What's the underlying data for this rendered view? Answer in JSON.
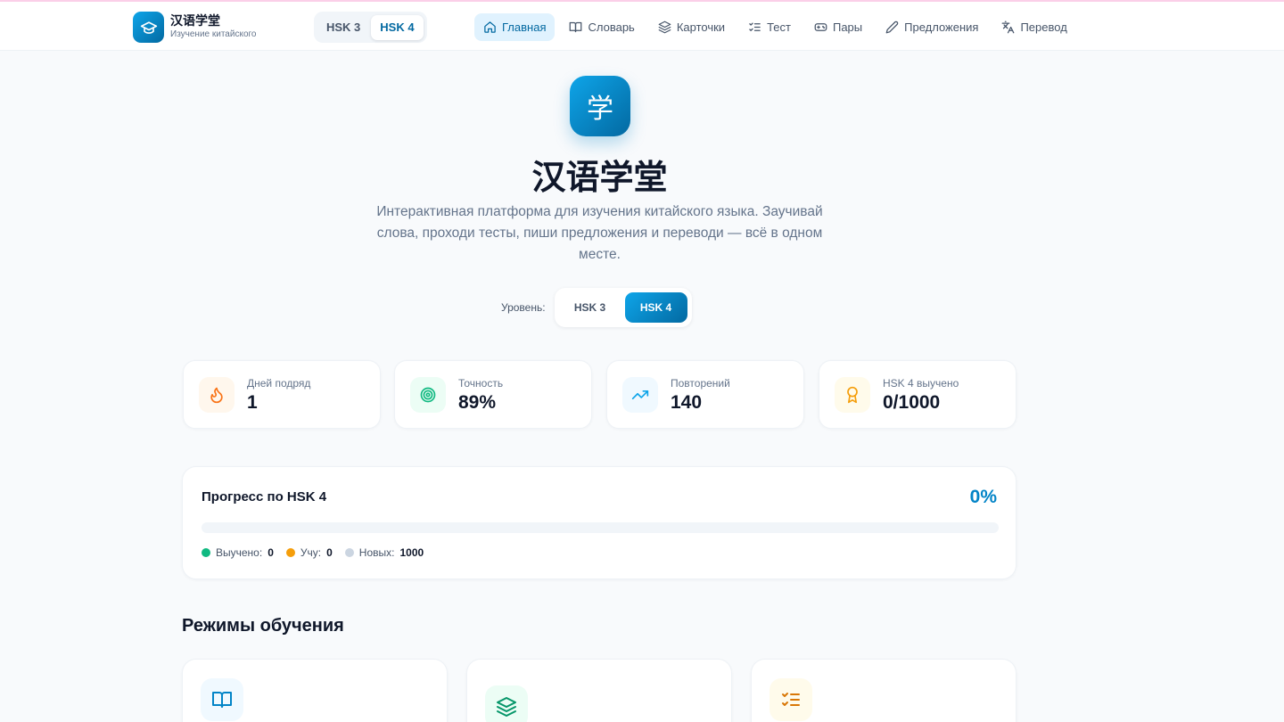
{
  "header": {
    "logo_char": "学",
    "title": "汉语学堂",
    "subtitle": "Изучение китайского",
    "levels": [
      "HSK 3",
      "HSK 4"
    ],
    "active_level": "HSK 4",
    "nav": [
      {
        "label": "Главная",
        "icon": "home-icon",
        "active": true
      },
      {
        "label": "Словарь",
        "icon": "book-icon",
        "active": false
      },
      {
        "label": "Карточки",
        "icon": "layers-icon",
        "active": false
      },
      {
        "label": "Тест",
        "icon": "list-check-icon",
        "active": false
      },
      {
        "label": "Пары",
        "icon": "gamepad-icon",
        "active": false
      },
      {
        "label": "Предложения",
        "icon": "pencil-icon",
        "active": false
      },
      {
        "label": "Перевод",
        "icon": "translate-icon",
        "active": false
      }
    ]
  },
  "hero": {
    "icon_char": "学",
    "title": "汉语学堂",
    "description": "Интерактивная платформа для изучения китайского языка. Заучивай слова, проходи тесты, пиши предложения и переводи — всё в одном месте."
  },
  "level_selector": {
    "label": "Уровень:",
    "options": [
      "HSK 3",
      "HSK 4"
    ],
    "selected": "HSK 4"
  },
  "stats": [
    {
      "label": "Дней подряд",
      "value": "1",
      "icon": "flame-icon",
      "color": "#f97316",
      "bg": "#fff7ed"
    },
    {
      "label": "Точность",
      "value": "89%",
      "icon": "target-icon",
      "color": "#10b981",
      "bg": "#ecfdf5"
    },
    {
      "label": "Повторений",
      "value": "140",
      "icon": "trending-up-icon",
      "color": "#0ea5e9",
      "bg": "#f0f9ff"
    },
    {
      "label": "HSK 4 выучено",
      "value": "0/1000",
      "icon": "award-icon",
      "color": "#f59e0b",
      "bg": "#fffbeb"
    }
  ],
  "progress": {
    "title": "Прогресс по HSK 4",
    "percent_label": "0%",
    "fill_fraction": 0,
    "legend": [
      {
        "label": "Выучено:",
        "value": "0",
        "color": "#10b981"
      },
      {
        "label": "Учу:",
        "value": "0",
        "color": "#f59e0b"
      },
      {
        "label": "Новых:",
        "value": "1000",
        "color": "#cbd5e1"
      }
    ]
  },
  "modes": {
    "title": "Режимы обучения",
    "items": [
      {
        "icon": "book-open-icon",
        "color": "#0284c7",
        "bg": "#f0f9ff"
      },
      {
        "icon": "layers-icon",
        "color": "#059669",
        "bg": "#ecfdf5"
      },
      {
        "icon": "list-check-icon",
        "color": "#d97706",
        "bg": "#fffbeb"
      }
    ]
  }
}
